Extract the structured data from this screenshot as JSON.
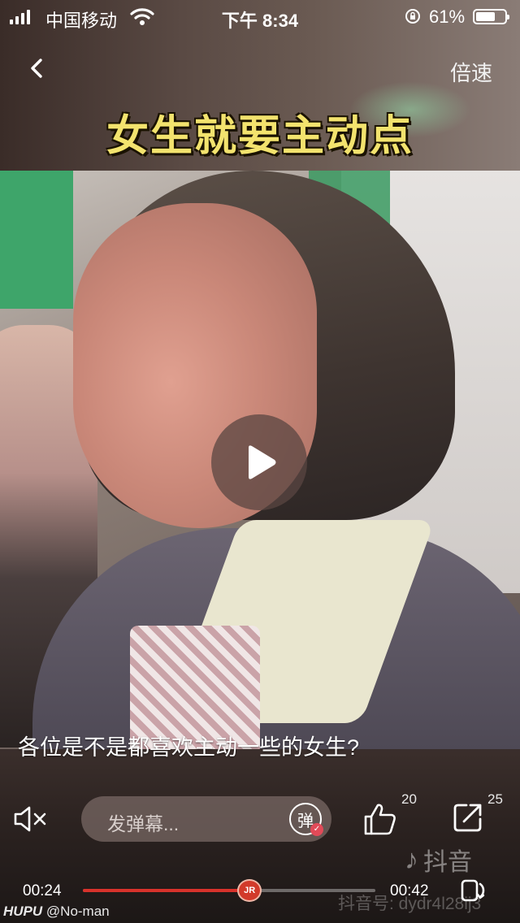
{
  "status_bar": {
    "carrier": "中国移动",
    "time": "下午 8:34",
    "battery_percent": "61%",
    "battery_level": 0.61
  },
  "nav": {
    "speed_label": "倍速"
  },
  "video": {
    "title": "女生就要主动点",
    "subtitle": "各位是不是都喜欢主动一些的女生?"
  },
  "actions": {
    "danmaku_placeholder": "发弹幕...",
    "danmaku_toggle_label": "弹",
    "like_count": "20",
    "share_count": "25"
  },
  "watermark": {
    "logo_text": "抖音",
    "douyin_id": "抖音号: dydr4l28ij3"
  },
  "progress": {
    "current_time": "00:24",
    "total_time": "00:42",
    "played_fraction": 0.57,
    "thumb_label": "JR"
  },
  "footer": {
    "brand": "HUPU",
    "user": "@No-man"
  },
  "icons": {
    "back": "chevron-left-icon",
    "play": "play-icon",
    "mute": "speaker-muted-icon",
    "like": "thumbs-up-icon",
    "share": "share-icon",
    "fullscreen": "rotate-fullscreen-icon"
  }
}
